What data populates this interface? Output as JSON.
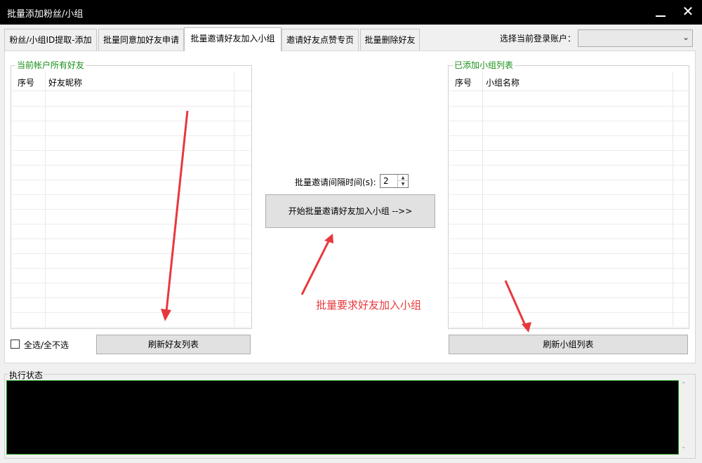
{
  "window": {
    "title": "批量添加粉丝/小组",
    "minimize_icon": "minimize-icon",
    "close_icon": "close-icon",
    "close_glyph": "✕"
  },
  "tabs": [
    {
      "label": "粉丝/小组ID提取-添加",
      "active": false
    },
    {
      "label": "批量同意加好友申请",
      "active": false
    },
    {
      "label": "批量邀请好友加入小组",
      "active": true
    },
    {
      "label": "邀请好友点赞专页",
      "active": false
    },
    {
      "label": "批量删除好友",
      "active": false
    }
  ],
  "account": {
    "label": "选择当前登录账户：",
    "value": ""
  },
  "friends_panel": {
    "legend": "当前帐户所有好友",
    "col_index": "序号",
    "col_name": "好友昵称",
    "rows": []
  },
  "groups_panel": {
    "legend": "已添加小组列表",
    "col_index": "序号",
    "col_name": "小组名称",
    "rows": []
  },
  "select_all": {
    "label": "全选/全不选",
    "checked": false
  },
  "refresh_friends_label": "刷新好友列表",
  "refresh_groups_label": "刷新小组列表",
  "interval": {
    "label": "批量邀请间隔时间(s):",
    "value": "2"
  },
  "start_button_label": "开始批量邀请好友加入小组 -->>",
  "annotation_text": "批量要求好友加入小组",
  "status": {
    "legend": "执行状态",
    "log": ""
  },
  "colors": {
    "legend_green": "#1a8f1a",
    "annotation_red": "#e8383d",
    "console_bg": "#000000"
  }
}
